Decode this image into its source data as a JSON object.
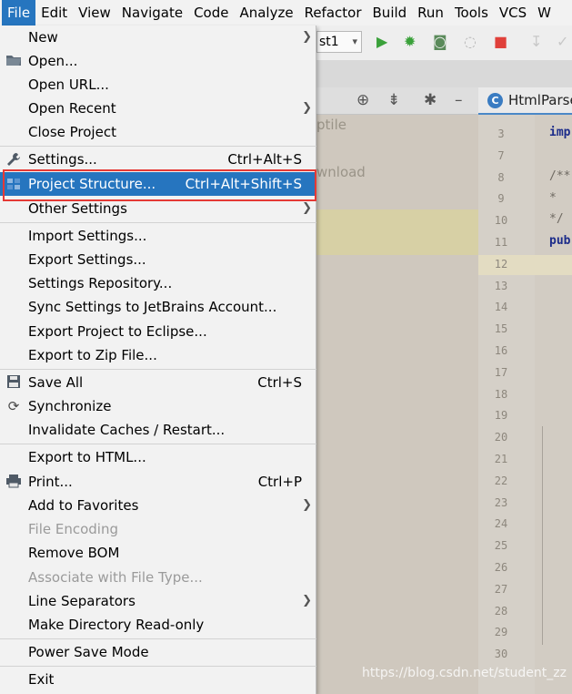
{
  "menubar": {
    "items": [
      "File",
      "Edit",
      "View",
      "Navigate",
      "Code",
      "Analyze",
      "Refactor",
      "Build",
      "Run",
      "Tools",
      "VCS",
      "W"
    ]
  },
  "toolbar": {
    "config_name": "st1"
  },
  "editor": {
    "tab_label": "HtmlParse",
    "line_numbers": [
      "3",
      "7",
      "8",
      "9",
      "10",
      "11",
      "12",
      "13",
      "14",
      "15",
      "16",
      "17",
      "18",
      "19",
      "20",
      "21",
      "22",
      "23",
      "24",
      "25",
      "26",
      "27",
      "28",
      "29",
      "30"
    ],
    "code_lines": [
      {
        "text": "imp",
        "style": "kw"
      },
      {
        "text": "/**",
        "style": "cm"
      },
      {
        "text": " *",
        "style": "cm"
      },
      {
        "text": " */",
        "style": "cm"
      },
      {
        "text": "pub",
        "style": "kw"
      }
    ]
  },
  "background_panel": {
    "ghost_text_1": "ptile",
    "ghost_text_2": "wnload"
  },
  "watermark": "https://blog.csdn.net/student_zz",
  "file_menu": {
    "items": [
      {
        "label": "New",
        "shortcut": "",
        "submenu": true,
        "icon": "",
        "disabled": false,
        "selected": false
      },
      {
        "label": "Open...",
        "shortcut": "",
        "submenu": false,
        "icon": "folder-icon",
        "disabled": false,
        "selected": false
      },
      {
        "label": "Open URL...",
        "shortcut": "",
        "submenu": false,
        "icon": "",
        "disabled": false,
        "selected": false
      },
      {
        "label": "Open Recent",
        "shortcut": "",
        "submenu": true,
        "icon": "",
        "disabled": false,
        "selected": false
      },
      {
        "label": "Close Project",
        "shortcut": "",
        "submenu": false,
        "icon": "",
        "disabled": false,
        "selected": false
      },
      {
        "label": "Settings...",
        "shortcut": "Ctrl+Alt+S",
        "submenu": false,
        "icon": "wrench-icon",
        "disabled": false,
        "selected": false
      },
      {
        "label": "Project Structure...",
        "shortcut": "Ctrl+Alt+Shift+S",
        "submenu": false,
        "icon": "project-structure-icon",
        "disabled": false,
        "selected": true
      },
      {
        "label": "Other Settings",
        "shortcut": "",
        "submenu": true,
        "icon": "",
        "disabled": false,
        "selected": false
      },
      {
        "label": "Import Settings...",
        "shortcut": "",
        "submenu": false,
        "icon": "",
        "disabled": false,
        "selected": false
      },
      {
        "label": "Export Settings...",
        "shortcut": "",
        "submenu": false,
        "icon": "",
        "disabled": false,
        "selected": false
      },
      {
        "label": "Settings Repository...",
        "shortcut": "",
        "submenu": false,
        "icon": "",
        "disabled": false,
        "selected": false
      },
      {
        "label": "Sync Settings to JetBrains Account...",
        "shortcut": "",
        "submenu": false,
        "icon": "",
        "disabled": false,
        "selected": false
      },
      {
        "label": "Export Project to Eclipse...",
        "shortcut": "",
        "submenu": false,
        "icon": "",
        "disabled": false,
        "selected": false
      },
      {
        "label": "Export to Zip File...",
        "shortcut": "",
        "submenu": false,
        "icon": "",
        "disabled": false,
        "selected": false
      },
      {
        "label": "Save All",
        "shortcut": "Ctrl+S",
        "submenu": false,
        "icon": "save-icon",
        "disabled": false,
        "selected": false
      },
      {
        "label": "Synchronize",
        "shortcut": "",
        "submenu": false,
        "icon": "sync-icon",
        "disabled": false,
        "selected": false
      },
      {
        "label": "Invalidate Caches / Restart...",
        "shortcut": "",
        "submenu": false,
        "icon": "",
        "disabled": false,
        "selected": false
      },
      {
        "label": "Export to HTML...",
        "shortcut": "",
        "submenu": false,
        "icon": "",
        "disabled": false,
        "selected": false
      },
      {
        "label": "Print...",
        "shortcut": "Ctrl+P",
        "submenu": false,
        "icon": "print-icon",
        "disabled": false,
        "selected": false
      },
      {
        "label": "Add to Favorites",
        "shortcut": "",
        "submenu": true,
        "icon": "",
        "disabled": false,
        "selected": false
      },
      {
        "label": "File Encoding",
        "shortcut": "",
        "submenu": false,
        "icon": "",
        "disabled": true,
        "selected": false
      },
      {
        "label": "Remove BOM",
        "shortcut": "",
        "submenu": false,
        "icon": "",
        "disabled": false,
        "selected": false
      },
      {
        "label": "Associate with File Type...",
        "shortcut": "",
        "submenu": false,
        "icon": "",
        "disabled": true,
        "selected": false
      },
      {
        "label": "Line Separators",
        "shortcut": "",
        "submenu": true,
        "icon": "",
        "disabled": false,
        "selected": false
      },
      {
        "label": "Make Directory Read-only",
        "shortcut": "",
        "submenu": false,
        "icon": "",
        "disabled": false,
        "selected": false
      },
      {
        "label": "Power Save Mode",
        "shortcut": "",
        "submenu": false,
        "icon": "",
        "disabled": false,
        "selected": false
      },
      {
        "label": "Exit",
        "shortcut": "",
        "submenu": false,
        "icon": "",
        "disabled": false,
        "selected": false
      }
    ]
  },
  "colors": {
    "accent": "#2675bf",
    "highlight_box": "#e53935",
    "run_green": "#3aa13a",
    "stop_red": "#e0403a"
  }
}
